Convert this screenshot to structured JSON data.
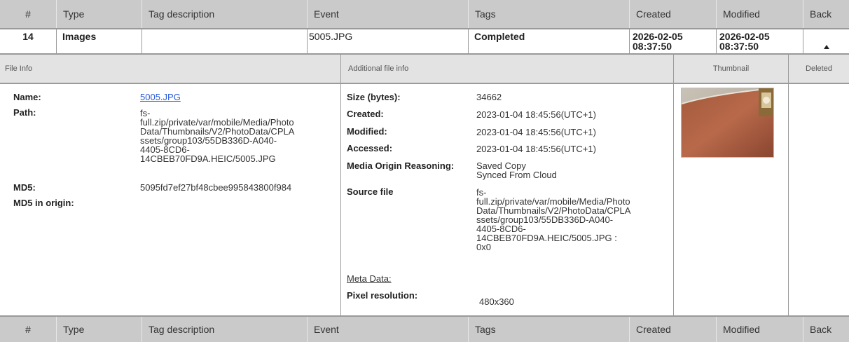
{
  "columns": {
    "num": "#",
    "type": "Type",
    "tag_description": "Tag description",
    "event": "Event",
    "tags": "Tags",
    "created": "Created",
    "modified": "Modified",
    "back": "Back"
  },
  "record": {
    "num": "14",
    "type": "Images",
    "tag_description": "",
    "event": "5005.JPG",
    "tags": "Completed",
    "created_line1": "2026-02-05",
    "created_line2": "08:37:50",
    "modified_line1": "2026-02-05",
    "modified_line2": "08:37:50",
    "back_icon": "caret-up-icon"
  },
  "sections": {
    "file_info": "File Info",
    "additional_file_info": "Additional file info",
    "thumbnail": "Thumbnail",
    "deleted": "Deleted"
  },
  "file_info": {
    "name_label": "Name:",
    "name_value": "5005.JPG",
    "path_label": "Path:",
    "path_lines": [
      "fs-",
      "full.zip/private/var/mobile/Media/Photo",
      "Data/Thumbnails/V2/PhotoData/CPLA",
      "ssets/group103/55DB336D-A040-",
      "4405-8CD6-",
      "14CBEB70FD9A.HEIC/5005.JPG"
    ],
    "md5_label": "MD5:",
    "md5_value": "5095fd7ef27bf48cbee995843800f984",
    "md5_origin_label": "MD5 in origin:"
  },
  "additional": {
    "size_label": "Size (bytes):",
    "size_value": "34662",
    "created_label": "Created:",
    "created_value": "2023-01-04 18:45:56(UTC+1)",
    "modified_label": "Modified:",
    "modified_value": "2023-01-04 18:45:56(UTC+1)",
    "accessed_label": "Accessed:",
    "accessed_value": "2023-01-04 18:45:56(UTC+1)",
    "origin_label": "Media Origin Reasoning:",
    "origin_line1": "Saved Copy",
    "origin_line2": "Synced From Cloud",
    "source_label": "Source file",
    "source_lines": [
      "fs-",
      "full.zip/private/var/mobile/Media/Photo",
      "Data/Thumbnails/V2/PhotoData/CPLA",
      "ssets/group103/55DB336D-A040-",
      "4405-8CD6-",
      "14CBEB70FD9A.HEIC/5005.JPG :",
      "0x0"
    ],
    "meta_label": "Meta Data:",
    "pixel_label": "Pixel resolution:",
    "pixel_value": "480x360"
  },
  "thumbnail": {
    "icon": "photo-thumbnail-arm-watch"
  },
  "colors": {
    "header_bg": "#cacaca",
    "subheader_bg": "#e3e3e3",
    "link": "#2a5bd7",
    "border": "#9a9a9a"
  }
}
